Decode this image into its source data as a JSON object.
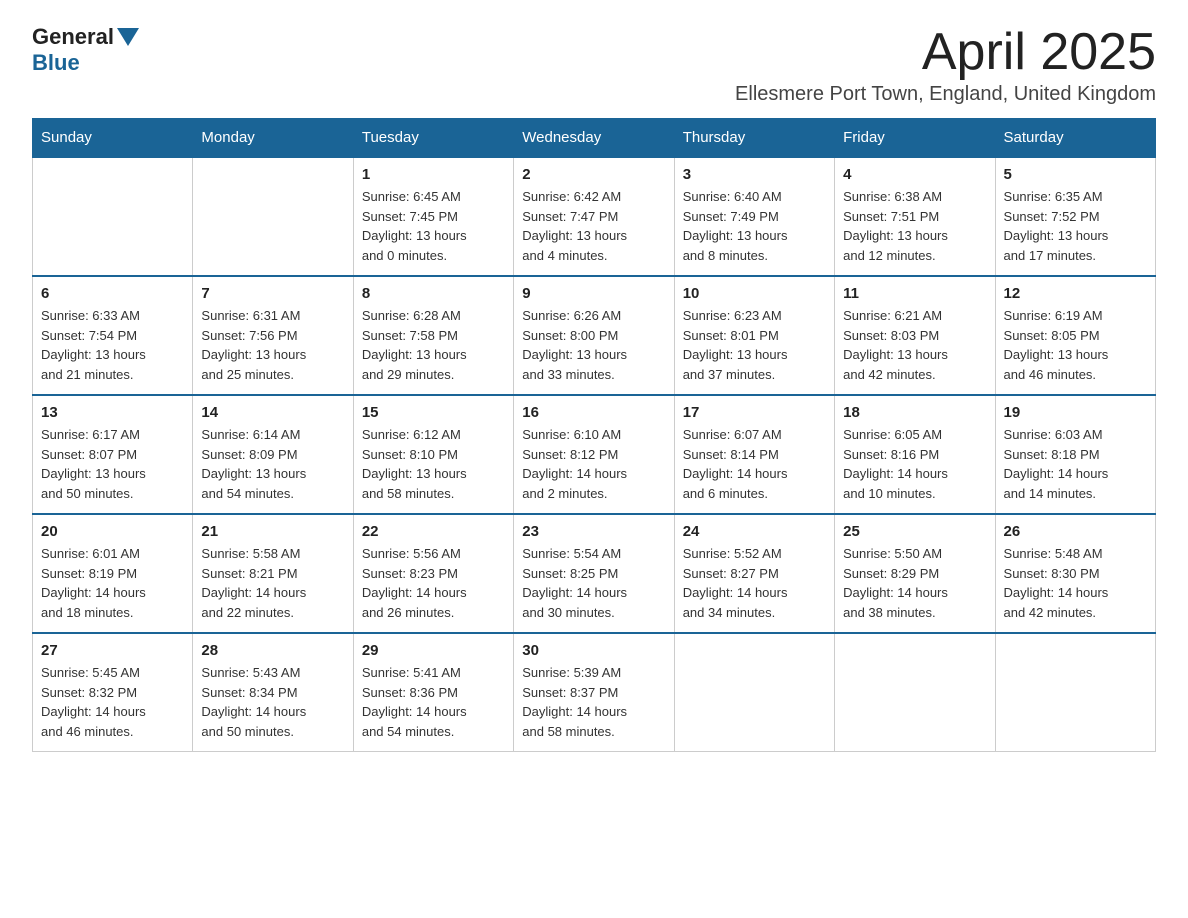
{
  "logo": {
    "general": "General",
    "blue": "Blue"
  },
  "header": {
    "month": "April 2025",
    "location": "Ellesmere Port Town, England, United Kingdom"
  },
  "days_of_week": [
    "Sunday",
    "Monday",
    "Tuesday",
    "Wednesday",
    "Thursday",
    "Friday",
    "Saturday"
  ],
  "weeks": [
    [
      {
        "day": "",
        "info": ""
      },
      {
        "day": "",
        "info": ""
      },
      {
        "day": "1",
        "info": "Sunrise: 6:45 AM\nSunset: 7:45 PM\nDaylight: 13 hours\nand 0 minutes."
      },
      {
        "day": "2",
        "info": "Sunrise: 6:42 AM\nSunset: 7:47 PM\nDaylight: 13 hours\nand 4 minutes."
      },
      {
        "day": "3",
        "info": "Sunrise: 6:40 AM\nSunset: 7:49 PM\nDaylight: 13 hours\nand 8 minutes."
      },
      {
        "day": "4",
        "info": "Sunrise: 6:38 AM\nSunset: 7:51 PM\nDaylight: 13 hours\nand 12 minutes."
      },
      {
        "day": "5",
        "info": "Sunrise: 6:35 AM\nSunset: 7:52 PM\nDaylight: 13 hours\nand 17 minutes."
      }
    ],
    [
      {
        "day": "6",
        "info": "Sunrise: 6:33 AM\nSunset: 7:54 PM\nDaylight: 13 hours\nand 21 minutes."
      },
      {
        "day": "7",
        "info": "Sunrise: 6:31 AM\nSunset: 7:56 PM\nDaylight: 13 hours\nand 25 minutes."
      },
      {
        "day": "8",
        "info": "Sunrise: 6:28 AM\nSunset: 7:58 PM\nDaylight: 13 hours\nand 29 minutes."
      },
      {
        "day": "9",
        "info": "Sunrise: 6:26 AM\nSunset: 8:00 PM\nDaylight: 13 hours\nand 33 minutes."
      },
      {
        "day": "10",
        "info": "Sunrise: 6:23 AM\nSunset: 8:01 PM\nDaylight: 13 hours\nand 37 minutes."
      },
      {
        "day": "11",
        "info": "Sunrise: 6:21 AM\nSunset: 8:03 PM\nDaylight: 13 hours\nand 42 minutes."
      },
      {
        "day": "12",
        "info": "Sunrise: 6:19 AM\nSunset: 8:05 PM\nDaylight: 13 hours\nand 46 minutes."
      }
    ],
    [
      {
        "day": "13",
        "info": "Sunrise: 6:17 AM\nSunset: 8:07 PM\nDaylight: 13 hours\nand 50 minutes."
      },
      {
        "day": "14",
        "info": "Sunrise: 6:14 AM\nSunset: 8:09 PM\nDaylight: 13 hours\nand 54 minutes."
      },
      {
        "day": "15",
        "info": "Sunrise: 6:12 AM\nSunset: 8:10 PM\nDaylight: 13 hours\nand 58 minutes."
      },
      {
        "day": "16",
        "info": "Sunrise: 6:10 AM\nSunset: 8:12 PM\nDaylight: 14 hours\nand 2 minutes."
      },
      {
        "day": "17",
        "info": "Sunrise: 6:07 AM\nSunset: 8:14 PM\nDaylight: 14 hours\nand 6 minutes."
      },
      {
        "day": "18",
        "info": "Sunrise: 6:05 AM\nSunset: 8:16 PM\nDaylight: 14 hours\nand 10 minutes."
      },
      {
        "day": "19",
        "info": "Sunrise: 6:03 AM\nSunset: 8:18 PM\nDaylight: 14 hours\nand 14 minutes."
      }
    ],
    [
      {
        "day": "20",
        "info": "Sunrise: 6:01 AM\nSunset: 8:19 PM\nDaylight: 14 hours\nand 18 minutes."
      },
      {
        "day": "21",
        "info": "Sunrise: 5:58 AM\nSunset: 8:21 PM\nDaylight: 14 hours\nand 22 minutes."
      },
      {
        "day": "22",
        "info": "Sunrise: 5:56 AM\nSunset: 8:23 PM\nDaylight: 14 hours\nand 26 minutes."
      },
      {
        "day": "23",
        "info": "Sunrise: 5:54 AM\nSunset: 8:25 PM\nDaylight: 14 hours\nand 30 minutes."
      },
      {
        "day": "24",
        "info": "Sunrise: 5:52 AM\nSunset: 8:27 PM\nDaylight: 14 hours\nand 34 minutes."
      },
      {
        "day": "25",
        "info": "Sunrise: 5:50 AM\nSunset: 8:29 PM\nDaylight: 14 hours\nand 38 minutes."
      },
      {
        "day": "26",
        "info": "Sunrise: 5:48 AM\nSunset: 8:30 PM\nDaylight: 14 hours\nand 42 minutes."
      }
    ],
    [
      {
        "day": "27",
        "info": "Sunrise: 5:45 AM\nSunset: 8:32 PM\nDaylight: 14 hours\nand 46 minutes."
      },
      {
        "day": "28",
        "info": "Sunrise: 5:43 AM\nSunset: 8:34 PM\nDaylight: 14 hours\nand 50 minutes."
      },
      {
        "day": "29",
        "info": "Sunrise: 5:41 AM\nSunset: 8:36 PM\nDaylight: 14 hours\nand 54 minutes."
      },
      {
        "day": "30",
        "info": "Sunrise: 5:39 AM\nSunset: 8:37 PM\nDaylight: 14 hours\nand 58 minutes."
      },
      {
        "day": "",
        "info": ""
      },
      {
        "day": "",
        "info": ""
      },
      {
        "day": "",
        "info": ""
      }
    ]
  ]
}
